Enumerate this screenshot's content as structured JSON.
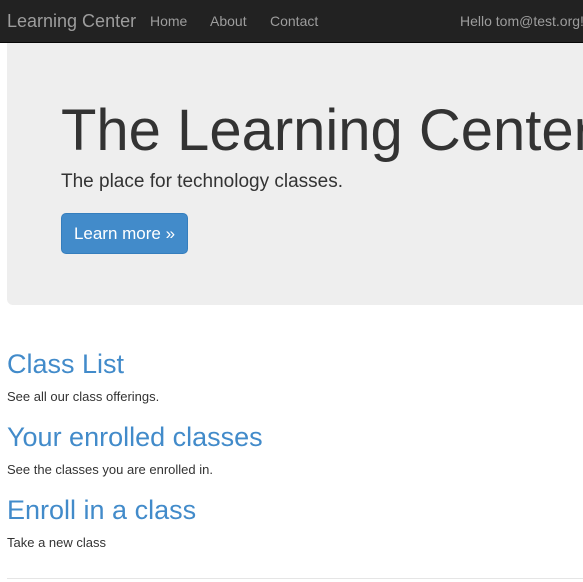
{
  "navbar": {
    "brand": "Learning Center",
    "links": [
      {
        "label": "Home"
      },
      {
        "label": "About"
      },
      {
        "label": "Contact"
      }
    ],
    "user_greeting": "Hello tom@test.org!"
  },
  "jumbotron": {
    "title": "The Learning Center",
    "lead": "The place for technology classes.",
    "button_label": "Learn more »"
  },
  "sections": [
    {
      "title": "Class List",
      "description": "See all our class offerings."
    },
    {
      "title": "Your enrolled classes",
      "description": "See the classes you are enrolled in."
    },
    {
      "title": "Enroll in a class",
      "description": "Take a new class"
    }
  ],
  "colors": {
    "navbar_bg": "#222222",
    "navbar_text": "#9d9d9d",
    "jumbotron_bg": "#eeeeee",
    "primary": "#428bca",
    "link": "#428bca",
    "text": "#333333"
  }
}
